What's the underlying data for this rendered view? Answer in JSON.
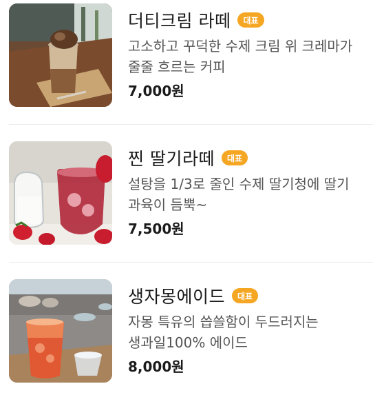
{
  "badge_color": "#f5a623",
  "items": [
    {
      "image": "dirty-cream-latte-photo",
      "name": "더티크림 라떼",
      "badge": "대표",
      "description": "고소하고 꾸덕한 수제 크림 위 크레마가 줄줄 흐르는 커피",
      "price": "7,000원"
    },
    {
      "image": "steamed-strawberry-latte-photo",
      "name": "찐 딸기라떼",
      "badge": "대표",
      "description": "설탕을 1/3로 줄인 수제 딸기청에 딸기 과육이 듬뿍~",
      "price": "7,500원"
    },
    {
      "image": "grapefruit-ade-photo",
      "name": "생자몽에이드",
      "badge": "대표",
      "description": "자몽 특유의 씁쓸함이 두드러지는 생과일100% 에이드",
      "price": "8,000원"
    }
  ]
}
